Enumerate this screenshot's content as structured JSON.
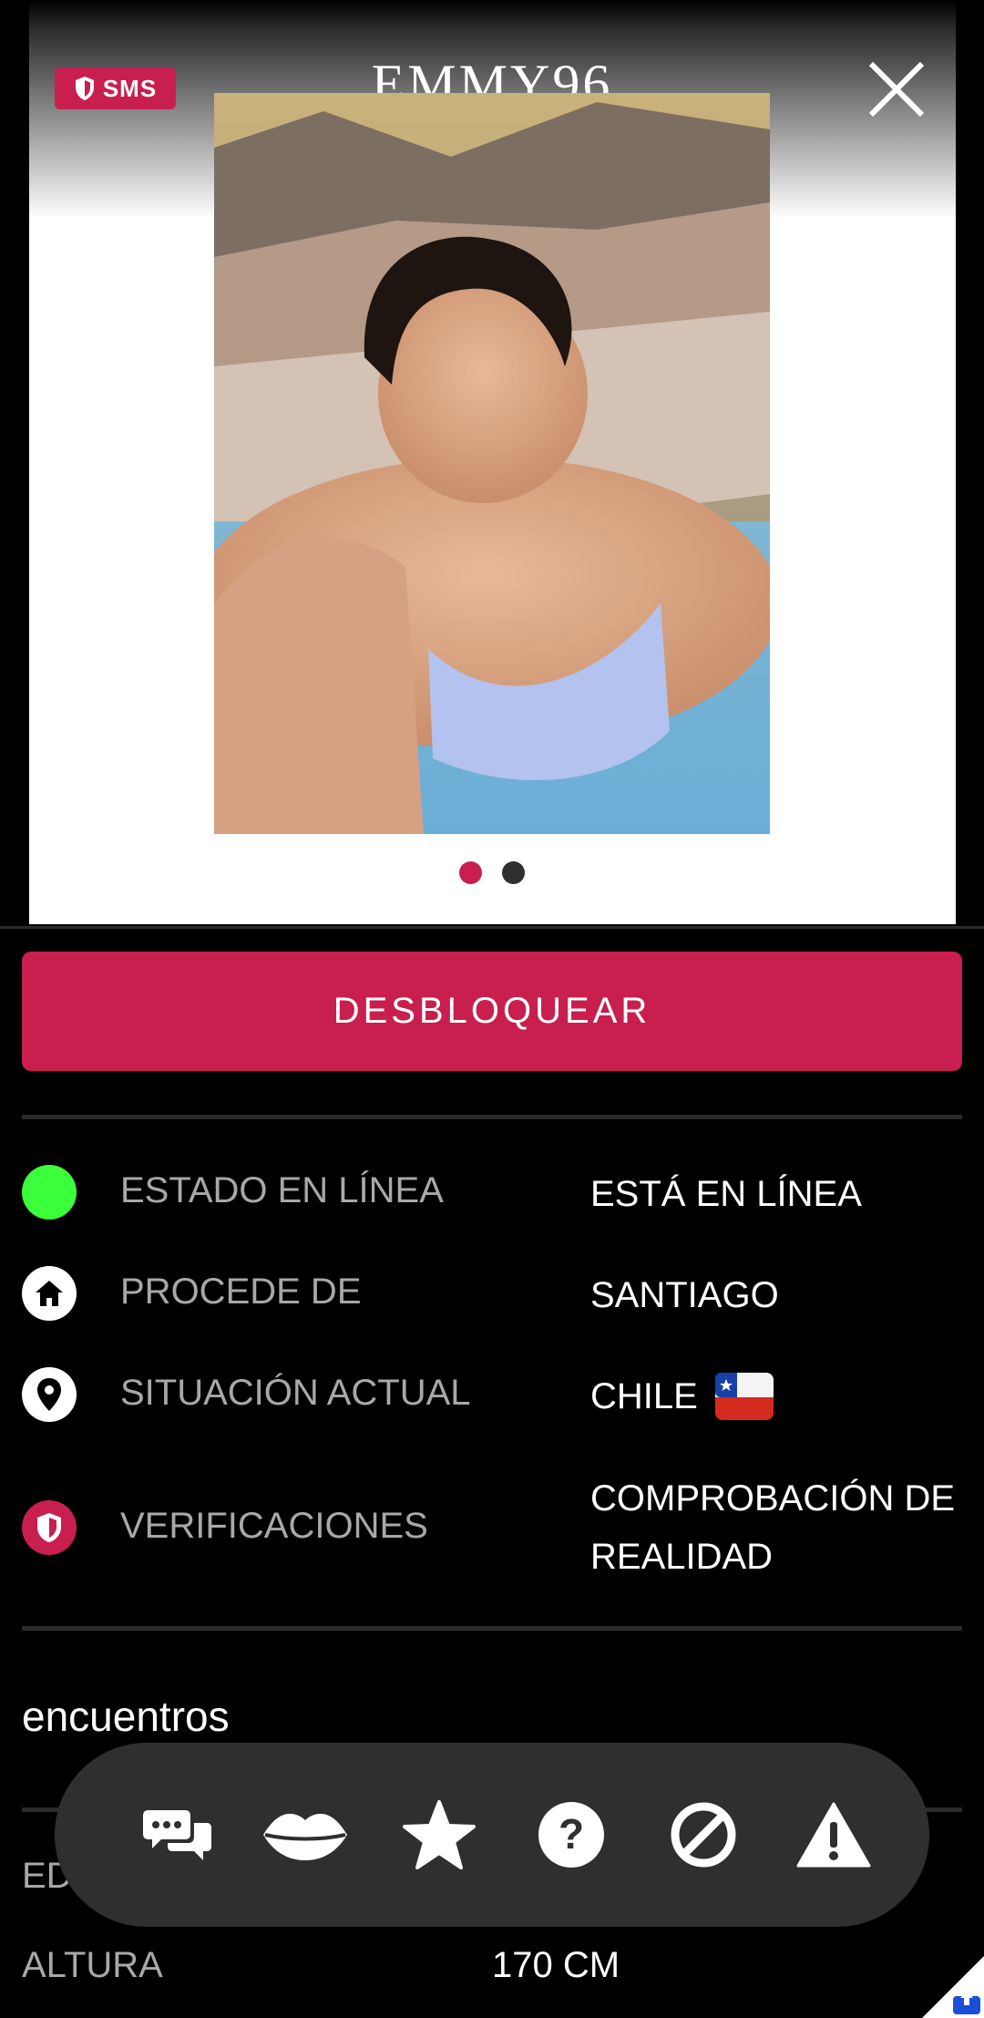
{
  "header": {
    "sms_badge": "SMS",
    "username": "EMMY96"
  },
  "photo": {
    "pages": 2,
    "current_page": 1,
    "active_dot_color": "#c81f4f",
    "inactive_dot_color": "#2f2f2f"
  },
  "unlock_button": "DESBLOQUEAR",
  "details": [
    {
      "icon": "online-status-icon",
      "label": "ESTADO EN LÍNEA",
      "value": "ESTÁ EN LÍNEA"
    },
    {
      "icon": "home-icon",
      "label": "PROCEDE DE",
      "value": "SANTIAGO"
    },
    {
      "icon": "location-pin-icon",
      "label": "SITUACIÓN ACTUAL",
      "value": "CHILE",
      "flag": "chile-flag-icon"
    },
    {
      "icon": "shield-icon",
      "label": "VERIFICACIONES",
      "value_line1": "COMPROBACIÓN DE",
      "value_line2": "REALIDAD"
    }
  ],
  "section": {
    "title": "encuentros"
  },
  "attributes": {
    "edad_label_partial": "ED",
    "altura_label": "ALTURA",
    "altura_value": "170 CM"
  },
  "action_bar": [
    {
      "icon": "chat-bubbles-icon",
      "name": "chat"
    },
    {
      "icon": "kiss-lips-icon",
      "name": "kiss"
    },
    {
      "icon": "star-icon",
      "name": "favorite"
    },
    {
      "icon": "question-icon",
      "name": "question"
    },
    {
      "icon": "block-icon",
      "name": "block"
    },
    {
      "icon": "warning-icon",
      "name": "report"
    }
  ],
  "colors": {
    "accent": "#c81f4f",
    "online": "#3bff3b",
    "background": "#000000",
    "label_gray": "#a8a8a8"
  }
}
